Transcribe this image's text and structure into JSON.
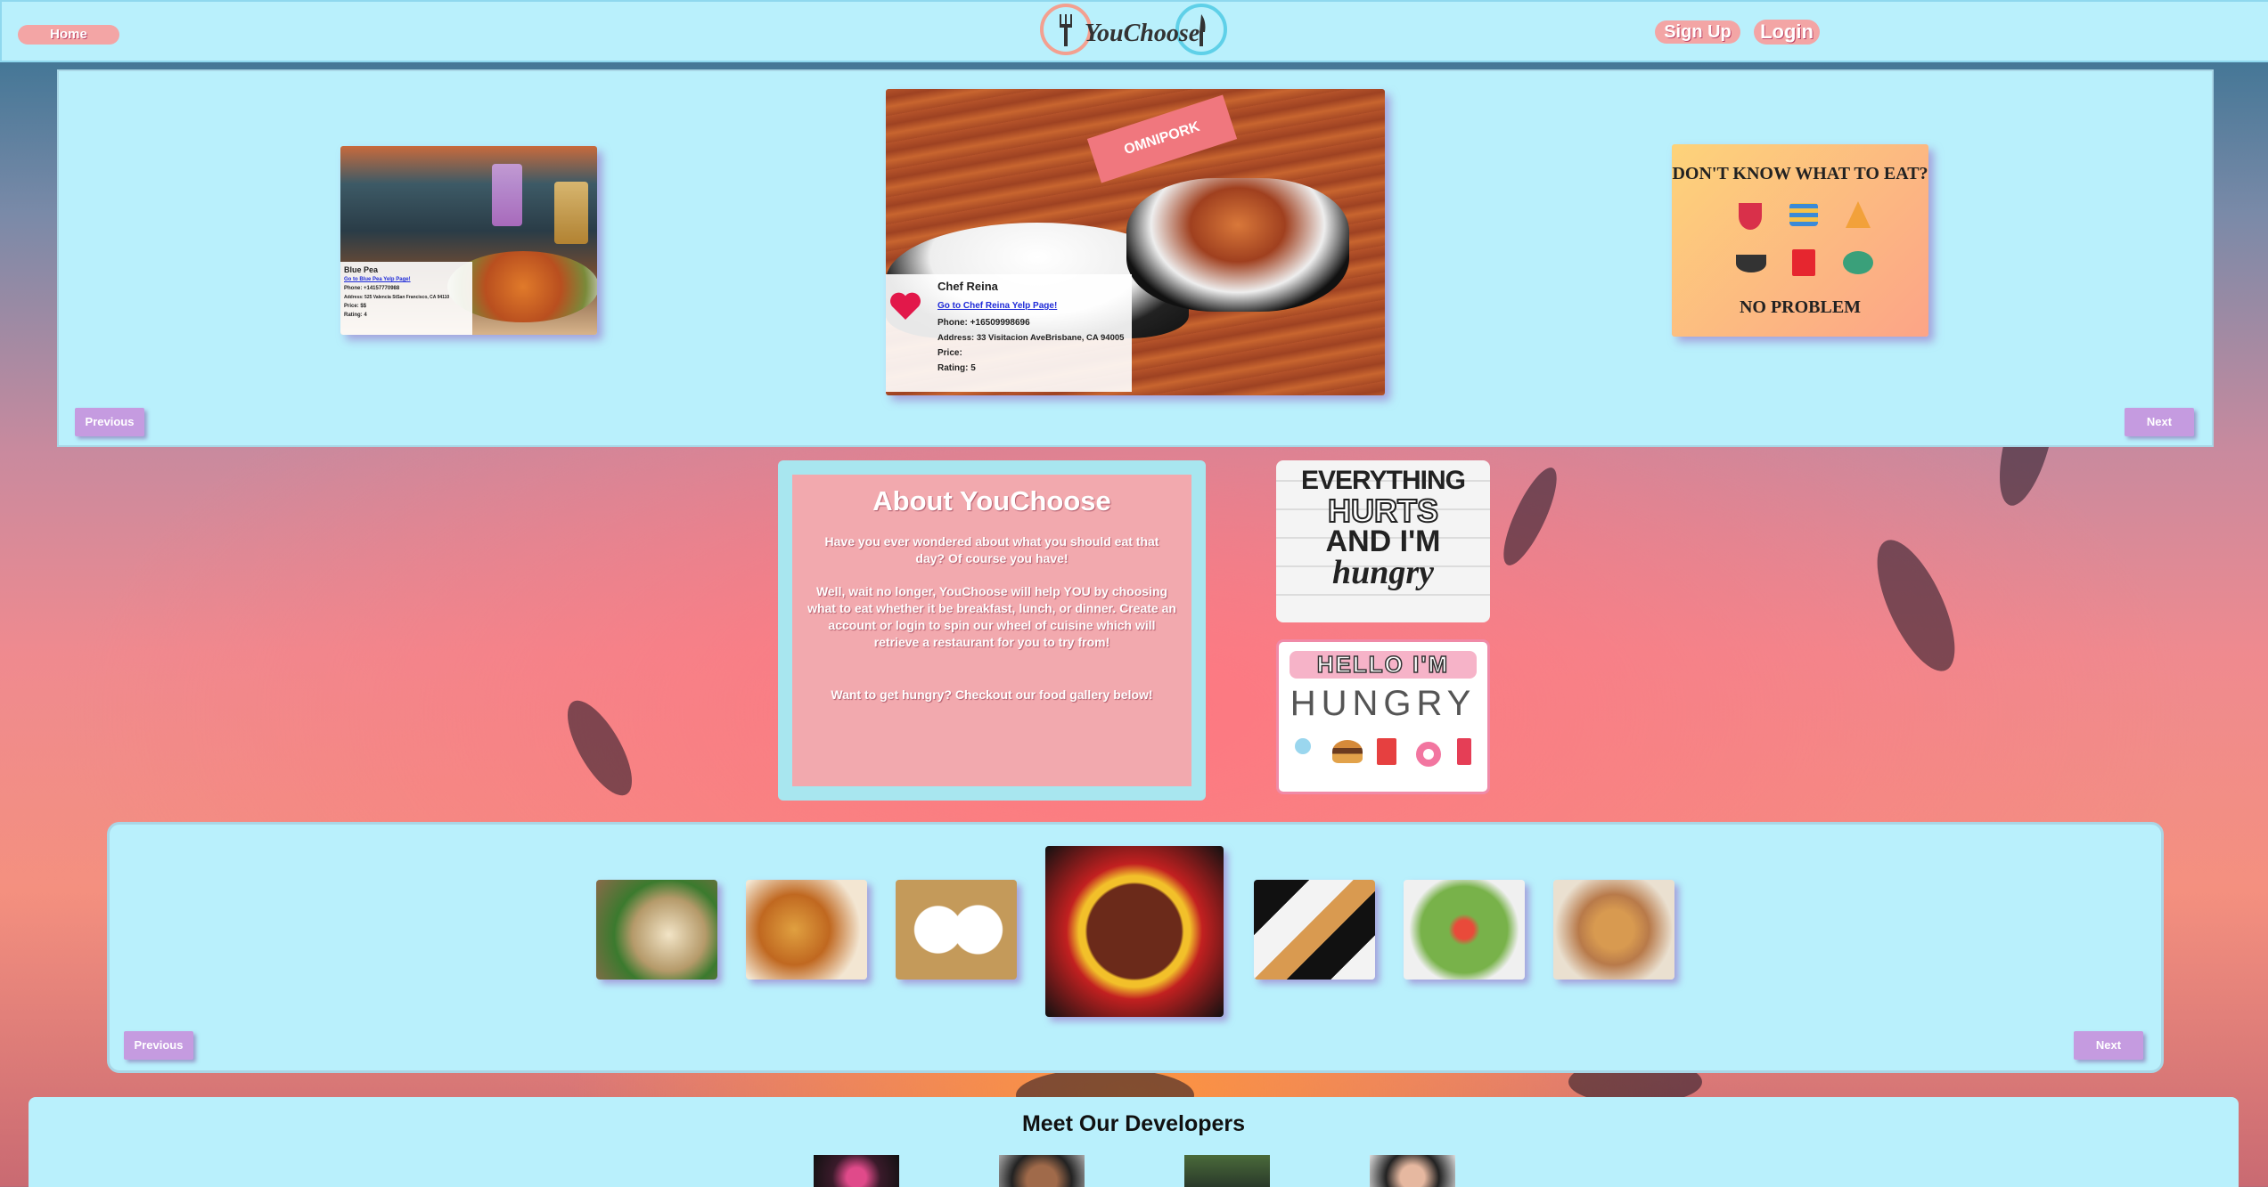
{
  "nav": {
    "home_label": "Home",
    "brand": "YouChoose",
    "signup_label": "Sign Up",
    "login_label": "Login"
  },
  "top_carousel": {
    "prev_label": "Previous",
    "next_label": "Next",
    "left_card": {
      "name": "Blue Pea",
      "link": "Go to Blue Pea Yelp Page!",
      "phone": "Phone: +14157770988",
      "address": "Address: 525 Valencia StSan Francisco, CA 94110",
      "price": "Price: $$",
      "rating": "Rating: 4"
    },
    "center_card": {
      "name": "Chef Reina",
      "link": "Go to Chef Reina Yelp Page!",
      "phone": "Phone: +16509998696",
      "address": "Address: 33 Visitacion AveBrisbane, CA 94005",
      "price": "Price:",
      "rating": "Rating: 5",
      "flag_text": "OMNIPORK"
    },
    "right_card": {
      "headline": "DON'T KNOW WHAT TO EAT?",
      "footer": "NO PROBLEM"
    }
  },
  "about": {
    "title": "About YouChoose",
    "p1": "Have you ever wondered about what you should eat that day? Of course you have!",
    "p2": "Well, wait no longer, YouChoose will help YOU by choosing what to eat whether it be breakfast, lunch, or dinner. Create an account or login to spin our wheel of cuisine which will retrieve a restaurant for you to try from!",
    "p3": "Want to get hungry? Checkout our food gallery below!"
  },
  "side_images": {
    "top": [
      "EVERYTHING",
      "HURTS",
      "AND I'M",
      "hungry"
    ],
    "bottom": [
      "HELLO I'M",
      "HUNGRY"
    ]
  },
  "gallery": {
    "prev_label": "Previous",
    "next_label": "Next"
  },
  "developers": {
    "title": "Meet Our Developers"
  }
}
